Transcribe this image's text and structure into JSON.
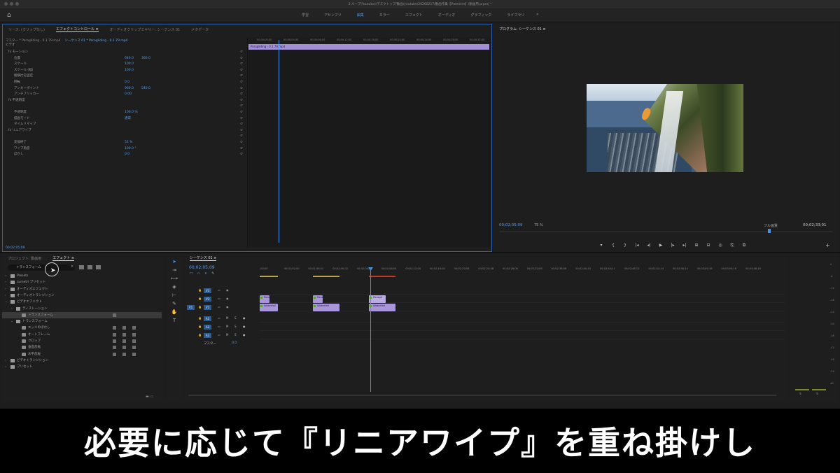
{
  "window": {
    "title": "2.ループ(Youtube)/デスクトップ/動画/youtube/20260217/動画作業【Premiere】/動画用.prproj *"
  },
  "workspaces": {
    "tabs": [
      "学習",
      "アセンブリ",
      "編集",
      "カラー",
      "エフェクト",
      "オーディオ",
      "グラフィック",
      "ライブラリ"
    ],
    "active": "編集",
    "more": "»"
  },
  "effect_panel": {
    "tabs": [
      "ソース: (クリップなし)",
      "エフェクトコントロール ≡",
      "オーディオクリップミキサー: シーケンス 01",
      "メタデータ"
    ],
    "sub_master": "マスター * Paragliding - 0.1.79.mp4",
    "sub_sequence": "シーケンス 01 * Paragliding - 0.1.79.mp4",
    "section_video": "ビデオ",
    "rows": [
      {
        "label": "fx モーション",
        "v1": "",
        "v2": ""
      },
      {
        "label": "位置",
        "v1": "640.0",
        "v2": "360.0"
      },
      {
        "label": "スケール",
        "v1": "100.0",
        "v2": ""
      },
      {
        "label": "スケール (幅)",
        "v1": "100.0",
        "v2": ""
      },
      {
        "label": "縦横比を固定",
        "v1": "",
        "v2": ""
      },
      {
        "label": "回転",
        "v1": "0.0",
        "v2": ""
      },
      {
        "label": "アンカーポイント",
        "v1": "960.0",
        "v2": "540.0"
      },
      {
        "label": "アンチフリッカー",
        "v1": "0.00",
        "v2": ""
      },
      {
        "label": "fx 不透明度",
        "v1": "",
        "v2": ""
      },
      {
        "label": "",
        "v1": "",
        "v2": ""
      },
      {
        "label": "不透明度",
        "v1": "100.0 %",
        "v2": ""
      },
      {
        "label": "描画モード",
        "v1": "通常",
        "v2": ""
      },
      {
        "label": "タイムリマップ",
        "v1": "",
        "v2": ""
      },
      {
        "label": "fx リニアワイプ",
        "v1": "",
        "v2": ""
      },
      {
        "label": "",
        "v1": "",
        "v2": ""
      },
      {
        "label": "変換終了",
        "v1": "52 %",
        "v2": ""
      },
      {
        "label": "ワイプ角度",
        "v1": "100.0 °",
        "v2": ""
      },
      {
        "label": "ぼかし",
        "v1": "0.0",
        "v2": ""
      }
    ],
    "ruler": [
      "00;00;00;00",
      "00;00;04;00",
      "00;00;08;00",
      "00;00;12;00",
      "00;00;16;00",
      "00;00;20;00",
      "00;00;24;00",
      "00;00;28;00",
      "00;00;32;00"
    ],
    "clip_label": "Paragliding - 0.1.79.mp4",
    "footer_tc": "00;02;05;09"
  },
  "program": {
    "title": "プログラム: シーケンス 01 ≡",
    "timecode": "00;02;05;09",
    "fit": "75 %",
    "quality": "フル画質",
    "duration": "00;02;33;01",
    "transport": [
      "▾",
      "{",
      "}",
      "|◂",
      "◂|",
      "▶",
      "|▸",
      "▸|",
      "⊞",
      "⊟",
      "◎",
      "⎘",
      "⧉"
    ],
    "add": "+"
  },
  "project_panel": {
    "tabs": [
      "プロジェクト: 動画用",
      "エフェクト ≡"
    ],
    "search_value": "トランスフォーム",
    "clear": "×",
    "tree": [
      {
        "indent": 0,
        "open": false,
        "icon": "folder",
        "label": "Presets"
      },
      {
        "indent": 0,
        "open": false,
        "icon": "folder",
        "label": "Lumetri プリセット"
      },
      {
        "indent": 0,
        "open": false,
        "icon": "folder",
        "label": "オーディオエフェクト"
      },
      {
        "indent": 0,
        "open": false,
        "icon": "folder",
        "label": "オーディオトランジション"
      },
      {
        "indent": 0,
        "open": true,
        "icon": "folder",
        "label": "ビデオエフェクト"
      },
      {
        "indent": 1,
        "open": true,
        "icon": "folder",
        "label": "ディストーション"
      },
      {
        "indent": 2,
        "open": null,
        "icon": "fx",
        "label": "トランスフォーム",
        "selected": true
      },
      {
        "indent": 1,
        "open": true,
        "icon": "folder",
        "label": "トランスフォーム"
      },
      {
        "indent": 2,
        "open": null,
        "icon": "fx",
        "label": "エッジのぼかし"
      },
      {
        "indent": 2,
        "open": null,
        "icon": "fx",
        "label": "オートフレーム"
      },
      {
        "indent": 2,
        "open": null,
        "icon": "fx",
        "label": "クロップ"
      },
      {
        "indent": 2,
        "open": null,
        "icon": "fx",
        "label": "垂直反転"
      },
      {
        "indent": 2,
        "open": null,
        "icon": "fx",
        "label": "水平反転"
      },
      {
        "indent": 0,
        "open": false,
        "icon": "folder",
        "label": "ビデオトランジション"
      },
      {
        "indent": 0,
        "open": false,
        "icon": "folder",
        "label": "プリセット"
      }
    ]
  },
  "timeline": {
    "title": "シーケンス 01 ≡",
    "timecode": "00;02;05;09",
    "ruler": [
      ";00;00",
      "00;01;52;00",
      "00;01;56;02",
      "00;02;00;02",
      "00;02;04;02",
      "00;02;08;04",
      "00;02;12;00",
      "00;02;16;00",
      "00;02;20;08",
      "00;02;24;08",
      "00;02;28;06",
      "00;02;32;08",
      "00;02;36;08",
      "00;02;40;10",
      "00;02;44;12",
      "00;02;48;12",
      "00;02;52;14",
      "00;02;56;14",
      "00;03;00;16",
      "00;03;04;16",
      "00;03;08;18"
    ],
    "tracks": [
      {
        "name": "V3",
        "src": ""
      },
      {
        "name": "V2",
        "src": ""
      },
      {
        "name": "V1",
        "src": "V1"
      },
      {
        "name": "A1",
        "src": ""
      },
      {
        "name": "A2",
        "src": ""
      },
      {
        "name": "A3",
        "src": ""
      }
    ],
    "master_label": "マスター",
    "master_value": "0.0",
    "clips": [
      {
        "track": "V2",
        "label": "Paragli"
      },
      {
        "track": "V1",
        "label": "Waterfall"
      },
      {
        "track": "V2",
        "label": "Paragl"
      },
      {
        "track": "V1",
        "label": "Waterfall"
      },
      {
        "track": "V2",
        "label": "Paragli"
      },
      {
        "track": "V1",
        "label": "Waterfall"
      }
    ]
  },
  "meters": {
    "labels": [
      "S",
      "S"
    ],
    "scale": [
      "0",
      "-6",
      "-12",
      "-18",
      "-24",
      "-30",
      "-36",
      "-42",
      "-48",
      "-54",
      "dB"
    ]
  },
  "caption": "必要に応じて『リニアワイプ』を重ね掛けし",
  "colors": {
    "accent": "#4a90e2",
    "clip": "#a996d8",
    "background": "#1d1d1d"
  }
}
